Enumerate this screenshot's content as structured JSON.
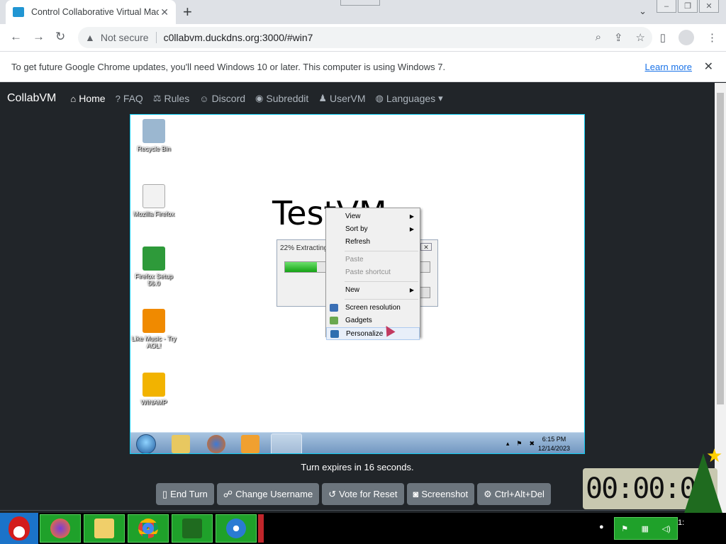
{
  "browser": {
    "tab_title": "Control Collaborative Virtual Machines",
    "new_tab_label": "+",
    "tab_close": "✕",
    "security_label": "Not secure",
    "url": "c0llabvm.duckdns.org:3000/#win7",
    "infobar_text": "To get future Google Chrome updates, you'll need Windows 10 or later. This computer is using Windows 7.",
    "infobar_link": "Learn more"
  },
  "site": {
    "brand": "CollabVM",
    "nav": [
      {
        "label": "Home",
        "icon": "home-icon"
      },
      {
        "label": "FAQ",
        "icon": "question-icon"
      },
      {
        "label": "Rules",
        "icon": "gavel-icon"
      },
      {
        "label": "Discord",
        "icon": "discord-icon"
      },
      {
        "label": "Subreddit",
        "icon": "reddit-icon"
      },
      {
        "label": "UserVM",
        "icon": "user-icon"
      },
      {
        "label": "Languages",
        "icon": "globe-icon"
      }
    ],
    "turn_text": "Turn expires in 16 seconds.",
    "buttons": [
      {
        "label": "End Turn",
        "icon": "computer-mouse-icon"
      },
      {
        "label": "Change Username",
        "icon": "users-icon"
      },
      {
        "label": "Vote for Reset",
        "icon": "rotate-left-icon"
      },
      {
        "label": "Screenshot",
        "icon": "camera-icon"
      },
      {
        "label": "Ctrl+Alt+Del",
        "icon": "gear-icon"
      }
    ]
  },
  "vm": {
    "desktop_icons": [
      {
        "label": "Recycle Bin",
        "color": "#9bb7d0"
      },
      {
        "label": "Mozilla Firefox",
        "color": "#f2f2f2"
      },
      {
        "label": "Firefox Setup 56.0",
        "color": "#2e9a3a"
      },
      {
        "label": "Like Music - Try AOL!",
        "color": "#f08a00"
      },
      {
        "label": "WINAMP",
        "color": "#f2b300"
      }
    ],
    "wallpaper_text": "TestVM",
    "dialog_title": "22% Extracting",
    "progress": 0.22,
    "context_menu": [
      {
        "label": "View",
        "arrow": "▶",
        "disabled": false
      },
      {
        "label": "Sort by",
        "arrow": "▶",
        "disabled": false
      },
      {
        "label": "Refresh",
        "arrow": "",
        "disabled": false
      },
      {
        "label": "Paste",
        "arrow": "",
        "disabled": true
      },
      {
        "label": "Paste shortcut",
        "arrow": "",
        "disabled": true
      },
      {
        "label": "New",
        "arrow": "▶",
        "disabled": false
      },
      {
        "label": "Screen resolution",
        "arrow": "",
        "disabled": false
      },
      {
        "label": "Gadgets",
        "arrow": "",
        "disabled": false
      },
      {
        "label": "Personalize",
        "arrow": "",
        "disabled": false
      }
    ],
    "clock_time": "6:15 PM",
    "clock_date": "12/14/2023"
  },
  "overlay_clock": "00:00:00",
  "host": {
    "tray_time": "1:"
  }
}
